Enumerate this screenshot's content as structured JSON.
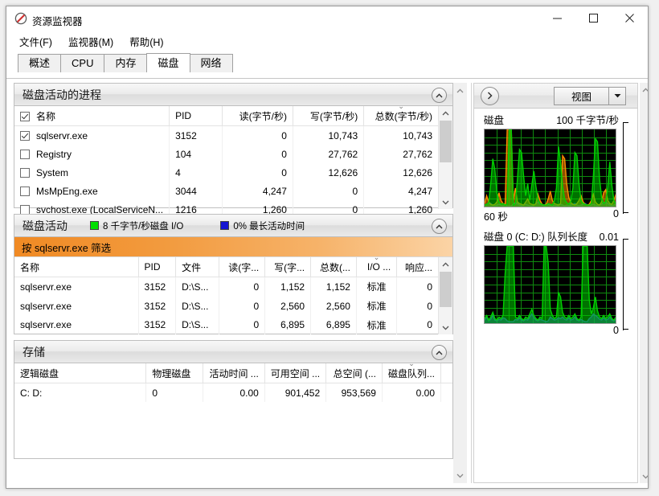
{
  "window": {
    "title": "资源监视器",
    "icon": "resource-monitor-icon",
    "minimize": "—",
    "maximize": "□",
    "close": "✕"
  },
  "menu": [
    {
      "label": "文件(F)"
    },
    {
      "label": "监视器(M)"
    },
    {
      "label": "帮助(H)"
    }
  ],
  "tabs": [
    {
      "label": "概述",
      "active": false
    },
    {
      "label": "CPU",
      "active": false
    },
    {
      "label": "内存",
      "active": false
    },
    {
      "label": "磁盘",
      "active": true
    },
    {
      "label": "网络",
      "active": false
    }
  ],
  "processes_section": {
    "title": "磁盘活动的进程",
    "collapse_icon": "chevron-up-icon",
    "columns": [
      {
        "label": "名称",
        "align": "left"
      },
      {
        "label": "PID",
        "align": "left"
      },
      {
        "label": "读(字节/秒)",
        "align": "right"
      },
      {
        "label": "写(字节/秒)",
        "align": "right"
      },
      {
        "label": "总数(字节/秒)",
        "align": "right",
        "sorted": true,
        "sort_marker": "⌄"
      }
    ],
    "rows": [
      {
        "checked": true,
        "name": "sqlservr.exe",
        "pid": "3152",
        "read": "0",
        "write": "10,743",
        "total": "10,743"
      },
      {
        "checked": false,
        "name": "Registry",
        "pid": "104",
        "read": "0",
        "write": "27,762",
        "total": "27,762"
      },
      {
        "checked": false,
        "name": "System",
        "pid": "4",
        "read": "0",
        "write": "12,626",
        "total": "12,626"
      },
      {
        "checked": false,
        "name": "MsMpEng.exe",
        "pid": "3044",
        "read": "4,247",
        "write": "0",
        "total": "4,247"
      },
      {
        "checked": false,
        "name": "svchost.exe (LocalServiceN...",
        "pid": "1216",
        "read": "1,260",
        "write": "0",
        "total": "1,260"
      }
    ]
  },
  "activity_section": {
    "title": "磁盘活动",
    "collapse_icon": "chevron-up-icon",
    "legends": [
      {
        "color": "#00e000",
        "text": "8 千字节/秒磁盘 I/O"
      },
      {
        "color": "#1414d2",
        "text": "0% 最长活动时间"
      }
    ],
    "filter_text": "按 sqlservr.exe 筛选",
    "columns": [
      {
        "label": "名称",
        "align": "left"
      },
      {
        "label": "PID",
        "align": "left"
      },
      {
        "label": "文件",
        "align": "left"
      },
      {
        "label": "读(字...",
        "align": "right"
      },
      {
        "label": "写(字...",
        "align": "right"
      },
      {
        "label": "总数(...",
        "align": "right"
      },
      {
        "label": "I/O ...",
        "align": "right",
        "sorted": true,
        "sort_marker": "⌄"
      },
      {
        "label": "响应...",
        "align": "right"
      }
    ],
    "rows": [
      {
        "name": "sqlservr.exe",
        "pid": "3152",
        "file": "D:\\S...",
        "read": "0",
        "write": "1,152",
        "total": "1,152",
        "io": "标准",
        "resp": "0"
      },
      {
        "name": "sqlservr.exe",
        "pid": "3152",
        "file": "D:\\S...",
        "read": "0",
        "write": "2,560",
        "total": "2,560",
        "io": "标准",
        "resp": "0"
      },
      {
        "name": "sqlservr.exe",
        "pid": "3152",
        "file": "D:\\S...",
        "read": "0",
        "write": "6,895",
        "total": "6,895",
        "io": "标准",
        "resp": "0"
      }
    ]
  },
  "storage_section": {
    "title": "存储",
    "collapse_icon": "chevron-up-icon",
    "columns": [
      {
        "label": "逻辑磁盘",
        "align": "left"
      },
      {
        "label": "物理磁盘",
        "align": "left"
      },
      {
        "label": "活动时间 ...",
        "align": "right"
      },
      {
        "label": "可用空间 ...",
        "align": "right"
      },
      {
        "label": "总空间 (...",
        "align": "right"
      },
      {
        "label": "磁盘队列...",
        "align": "right",
        "sorted": true,
        "sort_marker": "⌄"
      }
    ],
    "rows": [
      {
        "logical": "C: D:",
        "physical": "0",
        "active": "0.00",
        "free": "901,452",
        "total": "953,569",
        "queue": "0.00"
      }
    ]
  },
  "graph_panel": {
    "expand_icon": "chevron-right-icon",
    "view_label": "视图",
    "view_arrow_icon": "chevron-down-icon",
    "graphs": [
      {
        "title": "磁盘",
        "scale": "100 千字节/秒",
        "x_label": "60 秒",
        "y_min": "0"
      },
      {
        "title": "磁盘 0 (C: D:) 队列长度",
        "scale": "0.01",
        "x_label": "",
        "y_min": "0"
      }
    ]
  },
  "chart_data": [
    {
      "type": "area",
      "title": "磁盘",
      "ylabel": "千字节/秒",
      "ylim": [
        0,
        100
      ],
      "xlabel": "60 秒",
      "grid": true,
      "background": "#000000",
      "series": [
        {
          "name": "disk-io-green",
          "color": "#00d000",
          "values": [
            2,
            3,
            5,
            30,
            62,
            48,
            18,
            6,
            3,
            4,
            2,
            3,
            100,
            100,
            2,
            4,
            36,
            74,
            70,
            40,
            14,
            30,
            8,
            28,
            46,
            26,
            10,
            4,
            3,
            2,
            2,
            4,
            3,
            2,
            8,
            24,
            78,
            58,
            26,
            10,
            5,
            3,
            7,
            24,
            70,
            66,
            30,
            8,
            4,
            3,
            2,
            2,
            4,
            40,
            88,
            84,
            36,
            12,
            4,
            6,
            26,
            58,
            28,
            8,
            3,
            2
          ]
        },
        {
          "name": "disk-write-orange",
          "color": "#ff8c00",
          "values": [
            4,
            14,
            6,
            3,
            2,
            3,
            6,
            18,
            8,
            4,
            3,
            100,
            100,
            100,
            8,
            24,
            6,
            4,
            3,
            2,
            6,
            10,
            4,
            3,
            2,
            4,
            16,
            8,
            3,
            2,
            3,
            10,
            20,
            8,
            4,
            3,
            2,
            4,
            66,
            62,
            30,
            12,
            5,
            3,
            2,
            4,
            8,
            14,
            6,
            3,
            2,
            3,
            8,
            16,
            6,
            3,
            2,
            6,
            18,
            22,
            8,
            4,
            3,
            8,
            16,
            6
          ]
        },
        {
          "name": "disk-queue-blue",
          "color": "#3050e0",
          "values": [
            2,
            3,
            5,
            4,
            2,
            1,
            2,
            3,
            2,
            1,
            2,
            1,
            1,
            1,
            3,
            5,
            4,
            2,
            1,
            2,
            3,
            2,
            1,
            1,
            2,
            4,
            6,
            4,
            2,
            1,
            2,
            3,
            2,
            1,
            2,
            1,
            2,
            3,
            2,
            1,
            2,
            1,
            2,
            3,
            4,
            2,
            1,
            2,
            3,
            4,
            2,
            1,
            2,
            3,
            2,
            1,
            2,
            3,
            5,
            6,
            4,
            2,
            1,
            2,
            3,
            2
          ]
        }
      ]
    },
    {
      "type": "area",
      "title": "磁盘 0 (C: D:) 队列长度",
      "ylim": [
        0,
        0.01
      ],
      "grid": true,
      "background": "#000000",
      "series": [
        {
          "name": "queue-green",
          "color": "#00d000",
          "values": [
            6,
            10,
            4,
            8,
            14,
            6,
            4,
            8,
            6,
            10,
            64,
            100,
            100,
            100,
            100,
            8,
            6,
            10,
            6,
            4,
            8,
            6,
            12,
            18,
            10,
            6,
            4,
            8,
            6,
            100,
            100,
            78,
            18,
            10,
            6,
            8,
            40,
            34,
            14,
            8,
            6,
            10,
            6,
            8,
            12,
            6,
            4,
            8,
            100,
            100,
            100,
            30,
            12,
            20,
            34,
            16,
            8,
            6,
            10,
            6,
            8,
            12,
            6,
            4,
            8,
            6
          ]
        },
        {
          "name": "queue-blue",
          "color": "#3050e0",
          "values": [
            4,
            8,
            3,
            5,
            10,
            4,
            3,
            5,
            4,
            7,
            6,
            3,
            2,
            2,
            2,
            5,
            4,
            7,
            4,
            3,
            5,
            4,
            8,
            12,
            7,
            4,
            3,
            5,
            4,
            3,
            2,
            3,
            8,
            6,
            4,
            5,
            7,
            6,
            8,
            5,
            4,
            7,
            4,
            5,
            8,
            4,
            3,
            5,
            3,
            2,
            2,
            6,
            8,
            12,
            10,
            8,
            5,
            4,
            7,
            4,
            5,
            8,
            4,
            3,
            5,
            4
          ]
        }
      ]
    }
  ]
}
